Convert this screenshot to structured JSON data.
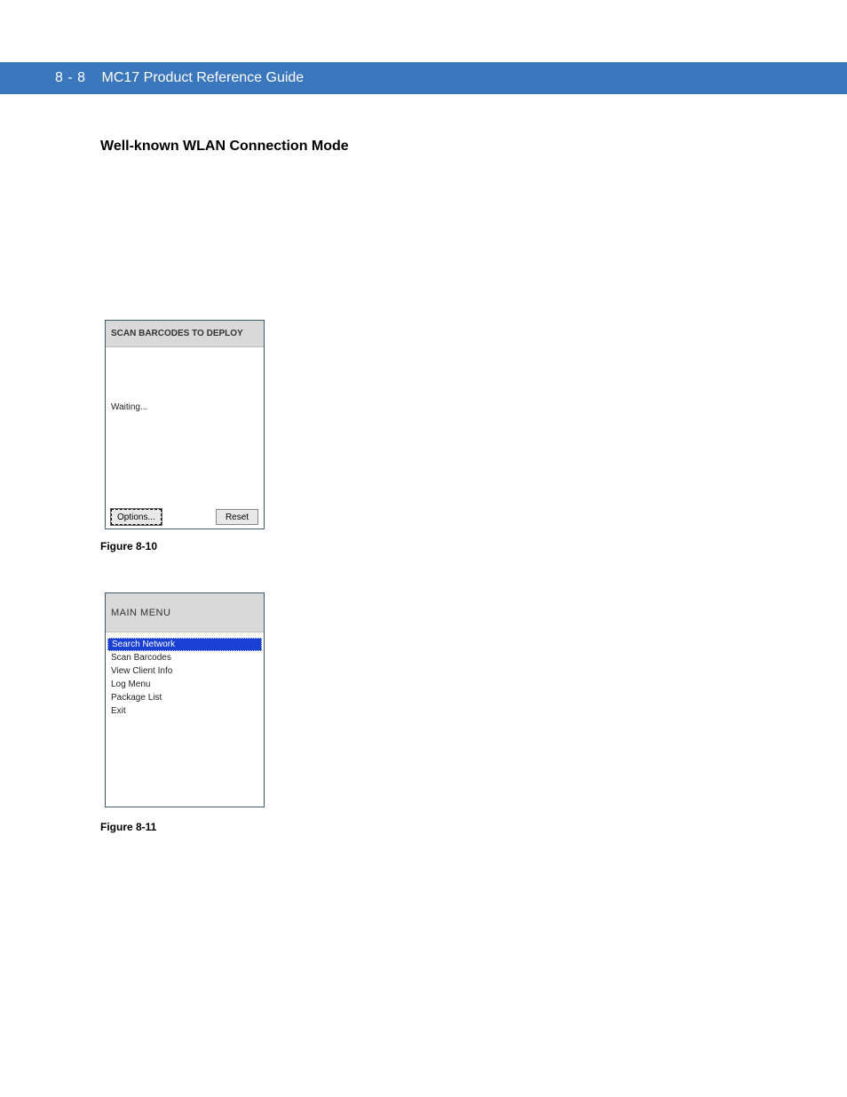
{
  "header": {
    "page_number": "8 - 8",
    "doc_title": "MC17 Product Reference Guide"
  },
  "section_heading": "Well-known WLAN Connection Mode",
  "figure1": {
    "titlebar": "SCAN BARCODES TO DEPLOY",
    "body_text": "Waiting...",
    "options_button": "Options...",
    "reset_button": "Reset",
    "caption": "Figure 8-10"
  },
  "figure2": {
    "titlebar": "MAIN MENU",
    "menu_items": [
      "Search Network",
      "Scan Barcodes",
      "View Client Info",
      "Log Menu",
      "Package List",
      "Exit"
    ],
    "selected_index": 0,
    "caption": "Figure 8-11"
  }
}
